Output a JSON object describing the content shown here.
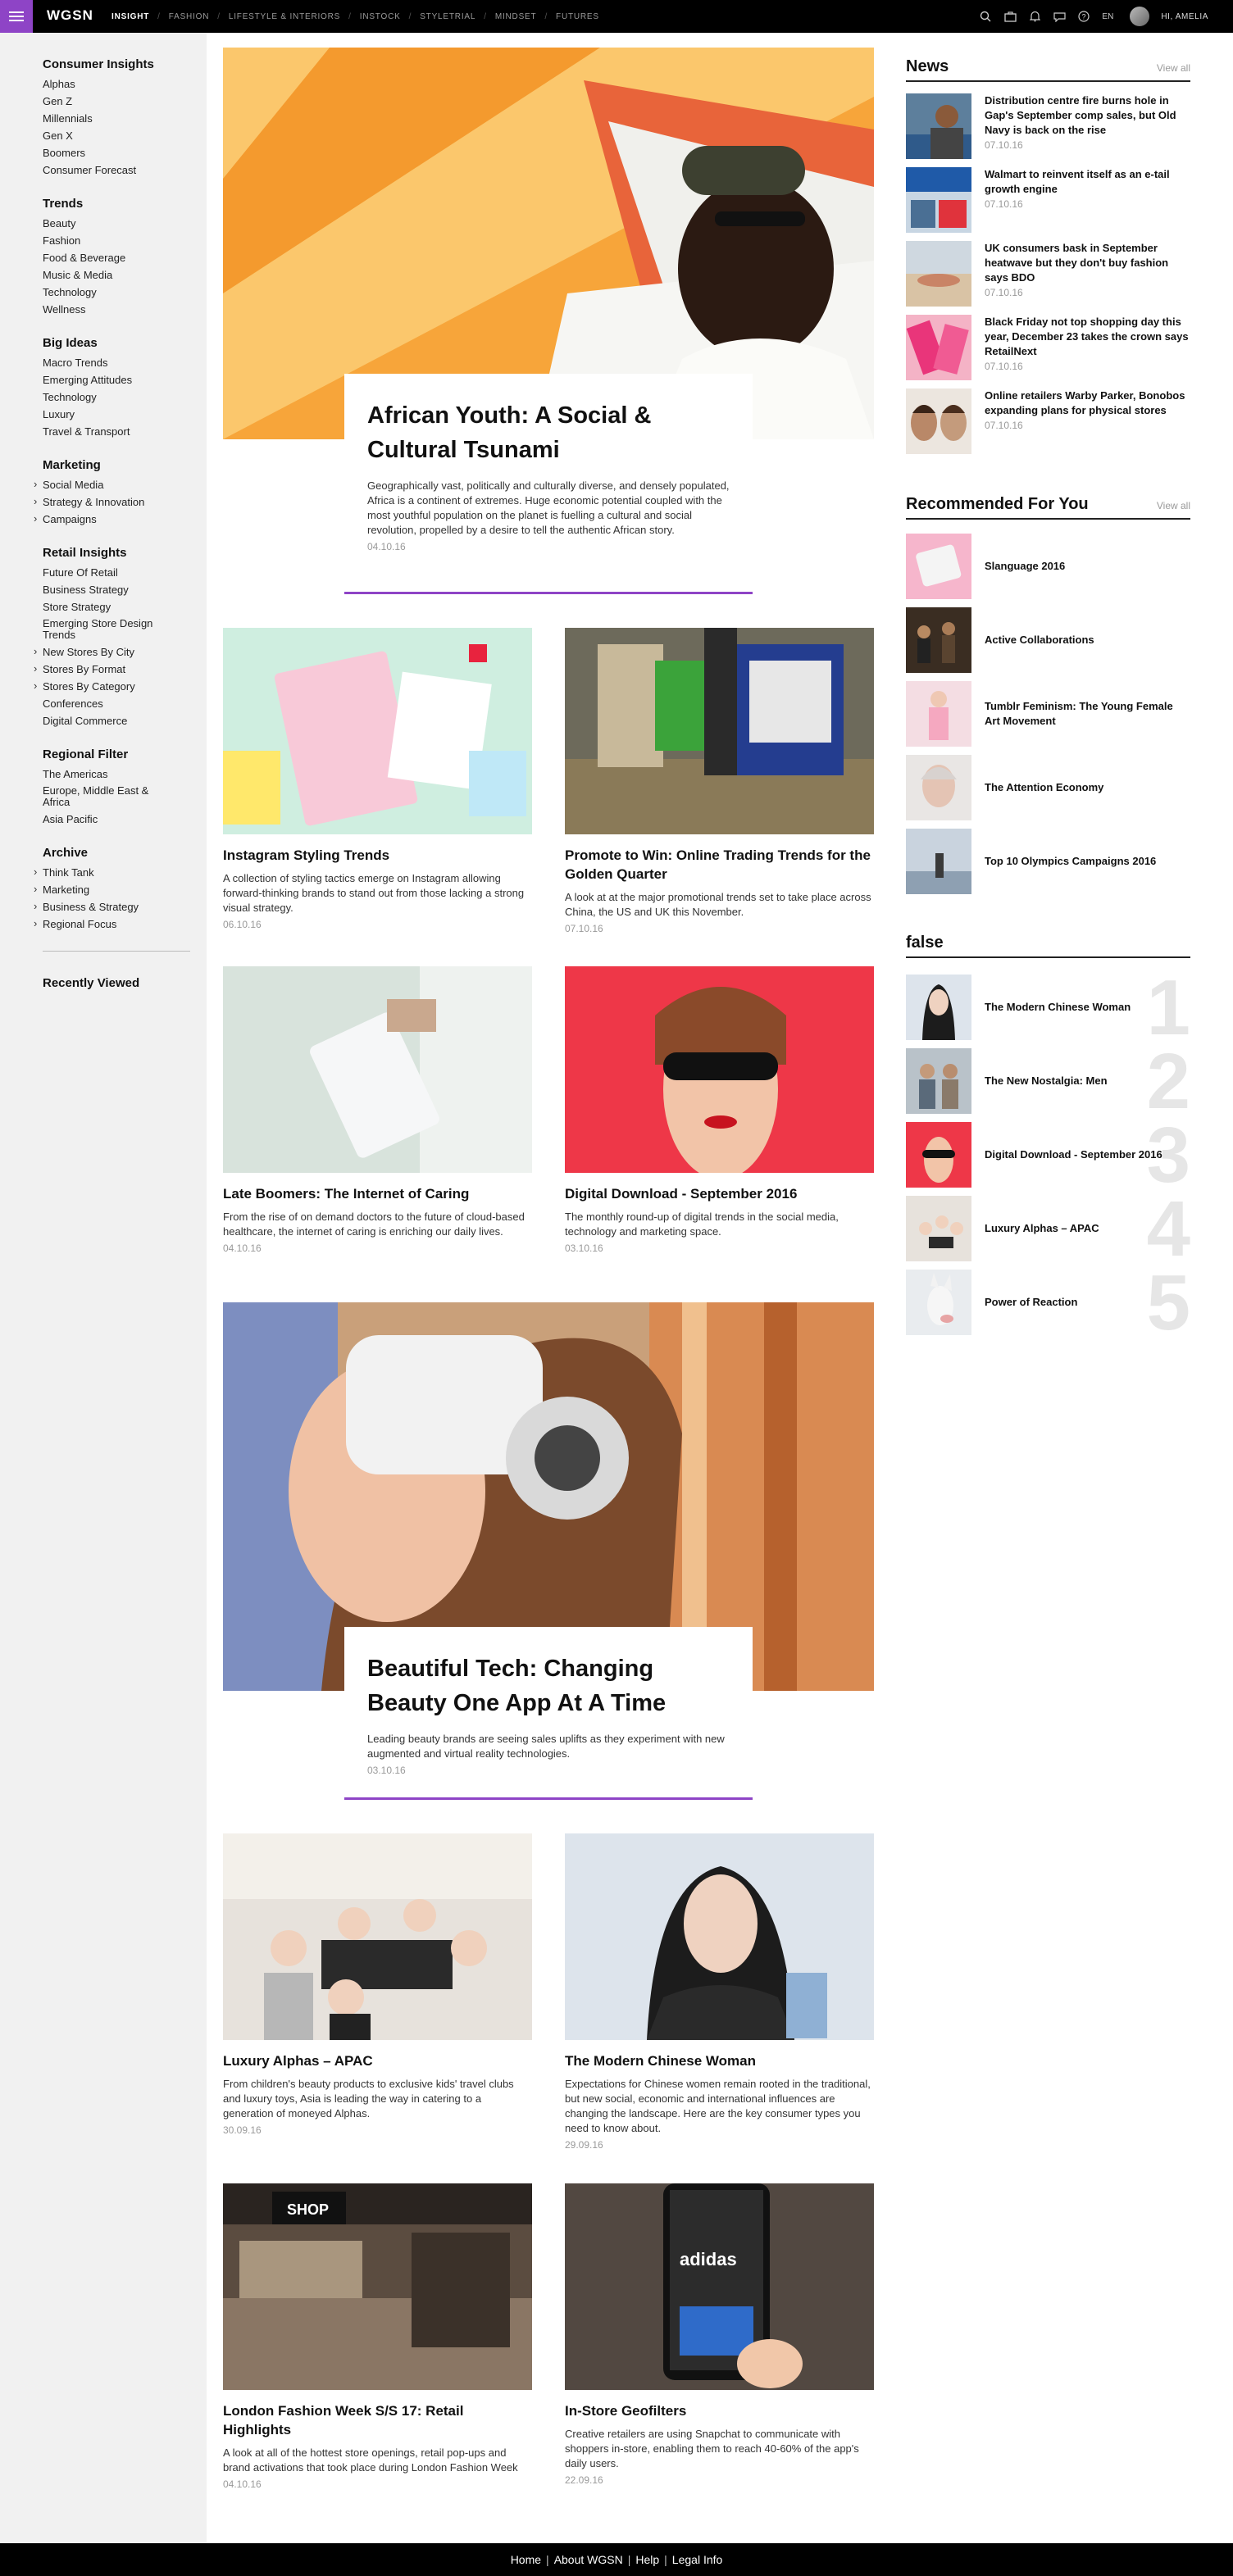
{
  "nav": {
    "logo": "WGSN",
    "links": [
      "INSIGHT",
      "FASHION",
      "LIFESTYLE & INTERIORS",
      "INSTOCK",
      "STYLETRIAL",
      "MINDSET",
      "FUTURES"
    ],
    "lang": "EN",
    "user": "HI, AMELIA"
  },
  "sidebar": {
    "groups": [
      {
        "title": "Consumer Insights",
        "items": [
          "Alphas",
          "Gen Z",
          "Millennials",
          "Gen X",
          "Boomers",
          "Consumer Forecast"
        ]
      },
      {
        "title": "Trends",
        "items": [
          "Beauty",
          "Fashion",
          "Food & Beverage",
          "Music & Media",
          "Technology",
          "Wellness"
        ]
      },
      {
        "title": "Big Ideas",
        "items": [
          "Macro Trends",
          "Emerging Attitudes",
          "Technology",
          "Luxury",
          "Travel & Transport"
        ]
      },
      {
        "title": "Marketing",
        "items": [
          "Social Media",
          "Strategy & Innovation",
          "Campaigns"
        ]
      },
      {
        "title": "Retail Insights",
        "items": [
          "Future Of Retail",
          "Business Strategy",
          "Store Strategy",
          "Emerging Store Design Trends",
          "New Stores By City",
          "Stores By Format",
          "Stores By Category",
          "Conferences",
          "Digital Commerce"
        ]
      },
      {
        "title": "Regional Filter",
        "items": [
          "The Americas",
          "Europe, Middle East & Africa",
          "Asia Pacific"
        ]
      },
      {
        "title": "Archive",
        "items": [
          "Think Tank",
          "Marketing",
          "Business & Strategy",
          "Regional Focus"
        ]
      }
    ],
    "recently_viewed": "Recently Viewed"
  },
  "hero1": {
    "title": "African Youth: A Social & Cultural Tsunami",
    "desc": "Geographically vast, politically and culturally diverse, and densely populated, Africa is a continent of extremes. Huge economic potential coupled with the most youthful population on the planet is fuelling a cultural and social revolution, propelled by a desire to tell the authentic African story.",
    "date": "04.10.16"
  },
  "cards_a": [
    {
      "title": "Instagram Styling Trends",
      "desc": "A collection of styling tactics emerge on Instagram allowing forward-thinking brands to stand out from those lacking a strong visual strategy.",
      "date": "06.10.16"
    },
    {
      "title": "Promote to Win: Online Trading Trends for the Golden Quarter",
      "desc": "A look at at the major promotional trends set to take place across China, the US and UK this November.",
      "date": "07.10.16"
    },
    {
      "title": "Late Boomers: The Internet of Caring",
      "desc": "From the rise of on demand doctors to the future of cloud-based healthcare, the internet of caring is enriching our daily lives.",
      "date": "04.10.16"
    },
    {
      "title": "Digital Download - September 2016",
      "desc": "The monthly round-up of digital trends in the social media, technology and marketing space.",
      "date": "03.10.16"
    }
  ],
  "hero2": {
    "title": "Beautiful Tech: Changing Beauty One App At A Time",
    "desc": "Leading beauty brands are seeing sales uplifts as they experiment with new augmented and virtual reality technologies.",
    "date": "03.10.16"
  },
  "cards_b": [
    {
      "title": "Luxury Alphas – APAC",
      "desc": "From children's beauty products to exclusive kids' travel clubs and luxury toys, Asia is leading the way in catering to a generation of moneyed Alphas.",
      "date": "30.09.16"
    },
    {
      "title": "The Modern Chinese Woman",
      "desc": "Expectations for Chinese women remain rooted in the traditional, but new social, economic and international influences are changing the landscape. Here are the key consumer types you need to know about.",
      "date": "29.09.16"
    },
    {
      "title": "London Fashion Week S/S 17: Retail Highlights",
      "desc": "A look at all of the hottest store openings, retail pop-ups and brand activations that took place during London Fashion Week",
      "date": "04.10.16"
    },
    {
      "title": "In-Store Geofilters",
      "desc": "Creative retailers are using Snapchat to communicate with shoppers in-store, enabling them to reach 40-60% of the app's daily users.",
      "date": "22.09.16"
    }
  ],
  "news": {
    "title": "News",
    "view_all": "View all",
    "items": [
      {
        "title": "Distribution centre fire burns hole in Gap's September comp sales, but Old Navy is back on the rise",
        "date": "07.10.16"
      },
      {
        "title": "Walmart to reinvent itself as an e-tail growth engine",
        "date": "07.10.16"
      },
      {
        "title": "UK consumers bask in September heatwave but they don't buy fashion says BDO",
        "date": "07.10.16"
      },
      {
        "title": "Black Friday not top shopping day this year, December 23 takes the crown says RetailNext",
        "date": "07.10.16"
      },
      {
        "title": "Online retailers Warby Parker, Bonobos expanding plans for physical stores",
        "date": "07.10.16"
      }
    ]
  },
  "recommended": {
    "title": "Recommended For You",
    "view_all": "View all",
    "items": [
      "Slanguage 2016",
      "Active Collaborations",
      "Tumblr Feminism: The Young Female Art Movement",
      "The Attention Economy",
      "Top 10 Olympics Campaigns 2016"
    ]
  },
  "popular": {
    "title": "false",
    "items": [
      {
        "rank": "1",
        "title": "The Modern Chinese Woman"
      },
      {
        "rank": "2",
        "title": "The New Nostalgia: Men"
      },
      {
        "rank": "3",
        "title": "Digital Download - September 2016"
      },
      {
        "rank": "4",
        "title": "Luxury Alphas – APAC"
      },
      {
        "rank": "5",
        "title": "Power of Reaction"
      }
    ]
  },
  "footer": {
    "links": [
      "Home",
      "About WGSN",
      "Help",
      "Legal Info"
    ]
  }
}
